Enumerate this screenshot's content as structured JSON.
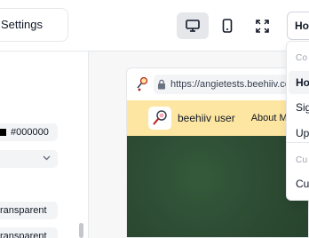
{
  "toolbar": {
    "settings_label": "Settings",
    "page_select_value": "Ho",
    "devices": [
      "desktop-icon",
      "mobile-icon",
      "fullscreen-icon"
    ]
  },
  "left_panel": {
    "color_value": "#000000",
    "transparent_1": "ransparent",
    "transparent_2": "ransparent"
  },
  "preview": {
    "url": "https://angietests.beehiiv.com",
    "newsletter_title": "beehiiv user",
    "nav_link": "About Me"
  },
  "dropdown": {
    "section_1": "Co",
    "items_1": [
      "Ho",
      "Sig",
      "Up"
    ],
    "section_2": "Cu",
    "items_2": [
      "Cu"
    ]
  },
  "colors": {
    "header_bg": "#fde6a1",
    "hero_bg": "#2e4d34"
  }
}
